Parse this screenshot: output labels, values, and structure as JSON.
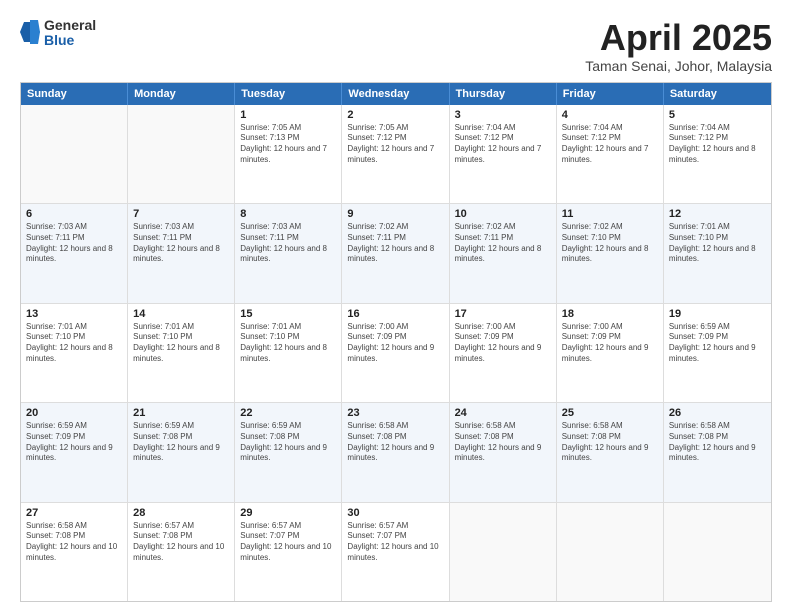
{
  "header": {
    "logo": {
      "line1": "General",
      "line2": "Blue"
    },
    "title": "April 2025",
    "location": "Taman Senai, Johor, Malaysia"
  },
  "calendar": {
    "days": [
      "Sunday",
      "Monday",
      "Tuesday",
      "Wednesday",
      "Thursday",
      "Friday",
      "Saturday"
    ],
    "rows": [
      [
        {
          "date": "",
          "sunrise": "",
          "sunset": "",
          "daylight": ""
        },
        {
          "date": "",
          "sunrise": "",
          "sunset": "",
          "daylight": ""
        },
        {
          "date": "1",
          "sunrise": "Sunrise: 7:05 AM",
          "sunset": "Sunset: 7:13 PM",
          "daylight": "Daylight: 12 hours and 7 minutes."
        },
        {
          "date": "2",
          "sunrise": "Sunrise: 7:05 AM",
          "sunset": "Sunset: 7:12 PM",
          "daylight": "Daylight: 12 hours and 7 minutes."
        },
        {
          "date": "3",
          "sunrise": "Sunrise: 7:04 AM",
          "sunset": "Sunset: 7:12 PM",
          "daylight": "Daylight: 12 hours and 7 minutes."
        },
        {
          "date": "4",
          "sunrise": "Sunrise: 7:04 AM",
          "sunset": "Sunset: 7:12 PM",
          "daylight": "Daylight: 12 hours and 7 minutes."
        },
        {
          "date": "5",
          "sunrise": "Sunrise: 7:04 AM",
          "sunset": "Sunset: 7:12 PM",
          "daylight": "Daylight: 12 hours and 8 minutes."
        }
      ],
      [
        {
          "date": "6",
          "sunrise": "Sunrise: 7:03 AM",
          "sunset": "Sunset: 7:11 PM",
          "daylight": "Daylight: 12 hours and 8 minutes."
        },
        {
          "date": "7",
          "sunrise": "Sunrise: 7:03 AM",
          "sunset": "Sunset: 7:11 PM",
          "daylight": "Daylight: 12 hours and 8 minutes."
        },
        {
          "date": "8",
          "sunrise": "Sunrise: 7:03 AM",
          "sunset": "Sunset: 7:11 PM",
          "daylight": "Daylight: 12 hours and 8 minutes."
        },
        {
          "date": "9",
          "sunrise": "Sunrise: 7:02 AM",
          "sunset": "Sunset: 7:11 PM",
          "daylight": "Daylight: 12 hours and 8 minutes."
        },
        {
          "date": "10",
          "sunrise": "Sunrise: 7:02 AM",
          "sunset": "Sunset: 7:11 PM",
          "daylight": "Daylight: 12 hours and 8 minutes."
        },
        {
          "date": "11",
          "sunrise": "Sunrise: 7:02 AM",
          "sunset": "Sunset: 7:10 PM",
          "daylight": "Daylight: 12 hours and 8 minutes."
        },
        {
          "date": "12",
          "sunrise": "Sunrise: 7:01 AM",
          "sunset": "Sunset: 7:10 PM",
          "daylight": "Daylight: 12 hours and 8 minutes."
        }
      ],
      [
        {
          "date": "13",
          "sunrise": "Sunrise: 7:01 AM",
          "sunset": "Sunset: 7:10 PM",
          "daylight": "Daylight: 12 hours and 8 minutes."
        },
        {
          "date": "14",
          "sunrise": "Sunrise: 7:01 AM",
          "sunset": "Sunset: 7:10 PM",
          "daylight": "Daylight: 12 hours and 8 minutes."
        },
        {
          "date": "15",
          "sunrise": "Sunrise: 7:01 AM",
          "sunset": "Sunset: 7:10 PM",
          "daylight": "Daylight: 12 hours and 8 minutes."
        },
        {
          "date": "16",
          "sunrise": "Sunrise: 7:00 AM",
          "sunset": "Sunset: 7:09 PM",
          "daylight": "Daylight: 12 hours and 9 minutes."
        },
        {
          "date": "17",
          "sunrise": "Sunrise: 7:00 AM",
          "sunset": "Sunset: 7:09 PM",
          "daylight": "Daylight: 12 hours and 9 minutes."
        },
        {
          "date": "18",
          "sunrise": "Sunrise: 7:00 AM",
          "sunset": "Sunset: 7:09 PM",
          "daylight": "Daylight: 12 hours and 9 minutes."
        },
        {
          "date": "19",
          "sunrise": "Sunrise: 6:59 AM",
          "sunset": "Sunset: 7:09 PM",
          "daylight": "Daylight: 12 hours and 9 minutes."
        }
      ],
      [
        {
          "date": "20",
          "sunrise": "Sunrise: 6:59 AM",
          "sunset": "Sunset: 7:09 PM",
          "daylight": "Daylight: 12 hours and 9 minutes."
        },
        {
          "date": "21",
          "sunrise": "Sunrise: 6:59 AM",
          "sunset": "Sunset: 7:08 PM",
          "daylight": "Daylight: 12 hours and 9 minutes."
        },
        {
          "date": "22",
          "sunrise": "Sunrise: 6:59 AM",
          "sunset": "Sunset: 7:08 PM",
          "daylight": "Daylight: 12 hours and 9 minutes."
        },
        {
          "date": "23",
          "sunrise": "Sunrise: 6:58 AM",
          "sunset": "Sunset: 7:08 PM",
          "daylight": "Daylight: 12 hours and 9 minutes."
        },
        {
          "date": "24",
          "sunrise": "Sunrise: 6:58 AM",
          "sunset": "Sunset: 7:08 PM",
          "daylight": "Daylight: 12 hours and 9 minutes."
        },
        {
          "date": "25",
          "sunrise": "Sunrise: 6:58 AM",
          "sunset": "Sunset: 7:08 PM",
          "daylight": "Daylight: 12 hours and 9 minutes."
        },
        {
          "date": "26",
          "sunrise": "Sunrise: 6:58 AM",
          "sunset": "Sunset: 7:08 PM",
          "daylight": "Daylight: 12 hours and 9 minutes."
        }
      ],
      [
        {
          "date": "27",
          "sunrise": "Sunrise: 6:58 AM",
          "sunset": "Sunset: 7:08 PM",
          "daylight": "Daylight: 12 hours and 10 minutes."
        },
        {
          "date": "28",
          "sunrise": "Sunrise: 6:57 AM",
          "sunset": "Sunset: 7:08 PM",
          "daylight": "Daylight: 12 hours and 10 minutes."
        },
        {
          "date": "29",
          "sunrise": "Sunrise: 6:57 AM",
          "sunset": "Sunset: 7:07 PM",
          "daylight": "Daylight: 12 hours and 10 minutes."
        },
        {
          "date": "30",
          "sunrise": "Sunrise: 6:57 AM",
          "sunset": "Sunset: 7:07 PM",
          "daylight": "Daylight: 12 hours and 10 minutes."
        },
        {
          "date": "",
          "sunrise": "",
          "sunset": "",
          "daylight": ""
        },
        {
          "date": "",
          "sunrise": "",
          "sunset": "",
          "daylight": ""
        },
        {
          "date": "",
          "sunrise": "",
          "sunset": "",
          "daylight": ""
        }
      ]
    ]
  }
}
